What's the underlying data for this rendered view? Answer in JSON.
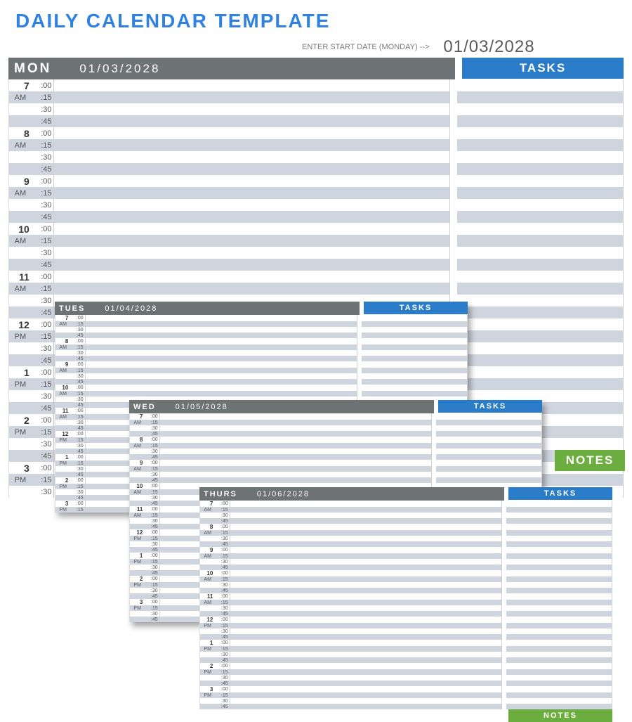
{
  "title": "DAILY CALENDAR TEMPLATE",
  "start_prompt": "ENTER START DATE (MONDAY)  -->",
  "start_date": "01/03/2028",
  "labels": {
    "tasks": "TASKS",
    "notes": "NOTES",
    "am": "AM",
    "pm": "PM"
  },
  "minutes": [
    ":00",
    ":15",
    ":30",
    ":45"
  ],
  "days": {
    "mon": {
      "code": "MON",
      "date": "01/03/2028"
    },
    "tues": {
      "code": "TUES",
      "date": "01/04/2028"
    },
    "wed": {
      "code": "WED",
      "date": "01/05/2028"
    },
    "thurs": {
      "code": "THURS",
      "date": "01/06/2028"
    }
  },
  "hours": [
    {
      "h": "7",
      "ampm": "AM"
    },
    {
      "h": "8",
      "ampm": "AM"
    },
    {
      "h": "9",
      "ampm": "AM"
    },
    {
      "h": "10",
      "ampm": "AM"
    },
    {
      "h": "11",
      "ampm": "AM"
    },
    {
      "h": "12",
      "ampm": "PM"
    },
    {
      "h": "1",
      "ampm": "PM"
    },
    {
      "h": "2",
      "ampm": "PM"
    },
    {
      "h": "3",
      "ampm": "PM"
    }
  ],
  "colors": {
    "accent_blue": "#2a7cc8",
    "accent_green": "#6cad3f",
    "header_grey": "#6d7272",
    "stripe": "#cfd5df"
  }
}
